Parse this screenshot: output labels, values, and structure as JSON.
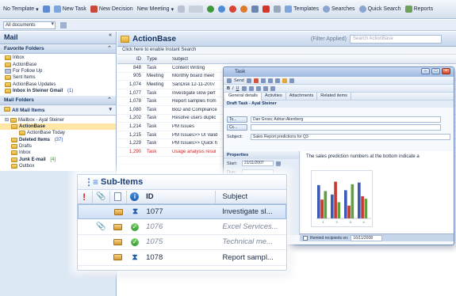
{
  "toolbar": {
    "items": [
      "No Template",
      "New Task",
      "New Decision",
      "New Meeting",
      "Templates",
      "Searches",
      "Quick Search",
      "Reports"
    ]
  },
  "row2": {
    "combo_value": "All documents"
  },
  "nav": {
    "title": "Mail",
    "favorites_header": "Favorite Folders",
    "favorites": [
      {
        "label": "Inbox"
      },
      {
        "label": "ActionBase"
      },
      {
        "label": "For Follow Up"
      },
      {
        "label": "Sent Items"
      },
      {
        "label": "ActionBase Updates"
      },
      {
        "label": "Inbox in Steiner Gmail",
        "count": "(1)"
      }
    ],
    "mail_folders_header": "Mail Folders",
    "all_mail_items": "All Mail Items",
    "tree": [
      {
        "label": "Mailbox - Ayal Steiner"
      },
      {
        "label": "ActionBase"
      },
      {
        "label": "ActionBase Today"
      },
      {
        "label": "Deleted Items",
        "count": "(37)"
      },
      {
        "label": "Drafts"
      },
      {
        "label": "Inbox"
      },
      {
        "label": "Junk E-mail",
        "count": "[4]"
      },
      {
        "label": "Outbox"
      }
    ]
  },
  "main": {
    "title": "ActionBase",
    "filter": "(Filter Applied)",
    "search_placeholder": "Search ActionBase",
    "instant_search": "Click here to enable Instant Search",
    "columns": [
      "ID",
      "Type",
      "Subject"
    ],
    "rows": [
      {
        "id": "848",
        "type": "Task",
        "subject": "Content Writing"
      },
      {
        "id": "905",
        "type": "Meeting",
        "subject": "Monthly board meet"
      },
      {
        "id": "1,074",
        "type": "Meeting",
        "subject": "SanDisk 12-11-2007"
      },
      {
        "id": "1,077",
        "type": "Task",
        "subject": "Investigate slow perf"
      },
      {
        "id": "1,078",
        "type": "Task",
        "subject": "Report samples from"
      },
      {
        "id": "1,080",
        "type": "Task",
        "subject": "BoD and Compliance"
      },
      {
        "id": "1,202",
        "type": "Task",
        "subject": "Resolve users duplic"
      },
      {
        "id": "1,214",
        "type": "Task",
        "subject": "PM Issues"
      },
      {
        "id": "1,215",
        "type": "Task",
        "subject": "PM Issues>> UI Valid"
      },
      {
        "id": "1,229",
        "type": "Task",
        "subject": "PM Issues>> Quick h"
      },
      {
        "id": "1,290",
        "type": "Task",
        "subject": "Usage analysis resul"
      }
    ]
  },
  "task_window": {
    "title": "Task",
    "send_label": "Send",
    "tabs": [
      "General details",
      "Activities",
      "Attachments",
      "Related items"
    ],
    "draft_label": "Draft Task - Ayal Steiner",
    "to_label": "To...",
    "to_value": "Dan Gross; Adrian Akenberg",
    "cc_label": "Cc...",
    "subject_label": "Subject:",
    "subject_value": "Sales Report predictions for Q3",
    "properties_label": "Properties",
    "start_label": "Start:",
    "start_value": "21/11/2007",
    "due_label": "Due:",
    "body_text": "The sales prediction numbers at the bottom indicate a",
    "remind_label": "Remind recipients on:",
    "remind_value": "16/11/2008"
  },
  "chart_data": {
    "type": "bar",
    "categories": [
      "1",
      "2",
      "3",
      "4"
    ],
    "series": [
      {
        "values": [
          78,
          56,
          66,
          84
        ]
      },
      {
        "values": [
          44,
          86,
          30,
          52
        ]
      },
      {
        "values": [
          64,
          38,
          80,
          46
        ]
      }
    ],
    "colors": [
      "#3b5bb4",
      "#c9392f",
      "#61a040"
    ]
  },
  "subitems": {
    "title": "Sub-Items",
    "columns": {
      "id": "ID",
      "subject": "Subject"
    },
    "rows": [
      {
        "id": "1077",
        "subject": "Investigate sl...",
        "clip": false,
        "status": "hour",
        "style": "selected"
      },
      {
        "id": "1076",
        "subject": "Excel Services...",
        "clip": true,
        "status": "check",
        "style": "muted"
      },
      {
        "id": "1075",
        "subject": "Technical me...",
        "clip": false,
        "status": "check",
        "style": "muted"
      },
      {
        "id": "1078",
        "subject": "Report sampl...",
        "clip": false,
        "status": "hour",
        "style": "normal"
      }
    ]
  }
}
